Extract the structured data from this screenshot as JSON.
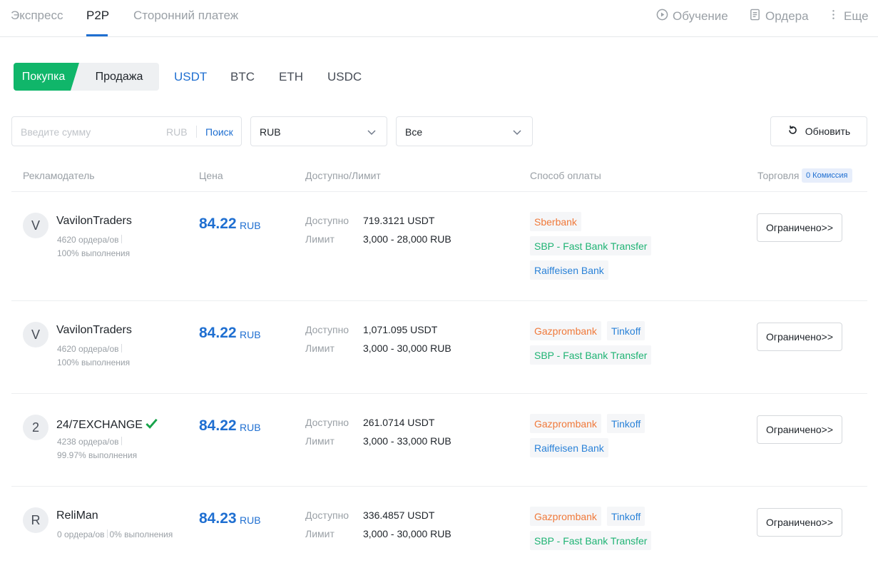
{
  "topnav": {
    "tabs": [
      "Экспресс",
      "P2P",
      "Сторонний платеж"
    ],
    "tutorial": "Обучение",
    "orders": "Ордера",
    "more": "Еще"
  },
  "trade_type": {
    "buy": "Покупка",
    "sell": "Продажа"
  },
  "coins": [
    "USDT",
    "BTC",
    "ETH",
    "USDC"
  ],
  "filters": {
    "amount_placeholder": "Введите сумму",
    "amount_currency": "RUB",
    "search": "Поиск",
    "fiat": "RUB",
    "payment": "Все",
    "refresh": "Обновить"
  },
  "table": {
    "headers": {
      "advertiser": "Рекламодатель",
      "price": "Цена",
      "available": "Доступно/Лимит",
      "payment": "Способ оплаты",
      "trade": "Торговля",
      "commission": "0 Комиссия"
    },
    "rows": [
      {
        "initial": "V",
        "name": "VavilonTraders",
        "orders": "4620 ордера/ов",
        "completion": "100% выполнения",
        "price": "84.22",
        "currency": "RUB",
        "available_label": "Доступно",
        "available": "719.3121 USDT",
        "limit_label": "Лимит",
        "limit": "3,000 - 28,000 RUB",
        "methods": [
          "Sberbank",
          "SBP - Fast Bank Transfer",
          "Raiffeisen Bank"
        ],
        "action": "Ограничено>>"
      },
      {
        "initial": "V",
        "name": "VavilonTraders",
        "orders": "4620 ордера/ов",
        "completion": "100% выполнения",
        "price": "84.22",
        "currency": "RUB",
        "available_label": "Доступно",
        "available": "1,071.095 USDT",
        "limit_label": "Лимит",
        "limit": "3,000 - 30,000 RUB",
        "methods": [
          "Gazprombank",
          "Tinkoff",
          "SBP - Fast Bank Transfer"
        ],
        "action": "Ограничено>>"
      },
      {
        "initial": "2",
        "name": "24/7EXCHANGE",
        "orders": "4238 ордера/ов",
        "completion": "99.97% выполнения",
        "price": "84.22",
        "currency": "RUB",
        "available_label": "Доступно",
        "available": "261.0714 USDT",
        "limit_label": "Лимит",
        "limit": "3,000 - 33,000 RUB",
        "methods": [
          "Gazprombank",
          "Tinkoff",
          "Raiffeisen Bank"
        ],
        "action": "Ограничено>>"
      },
      {
        "initial": "R",
        "name": "ReliMan",
        "orders": "0 ордера/ов",
        "completion": "0% выполнения",
        "price": "84.23",
        "currency": "RUB",
        "available_label": "Доступно",
        "available": "336.4857 USDT",
        "limit_label": "Лимит",
        "limit": "3,000 - 30,000 RUB",
        "methods": [
          "Gazprombank",
          "Tinkoff",
          "SBP - Fast Bank Transfer"
        ],
        "action": "Ограничено>>"
      }
    ]
  },
  "colors": {
    "accent": "#1f6fd1",
    "buy": "#10b66a",
    "method_orange": "#f0793a",
    "method_green": "#1fb374",
    "method_blue": "#2a82d8"
  }
}
